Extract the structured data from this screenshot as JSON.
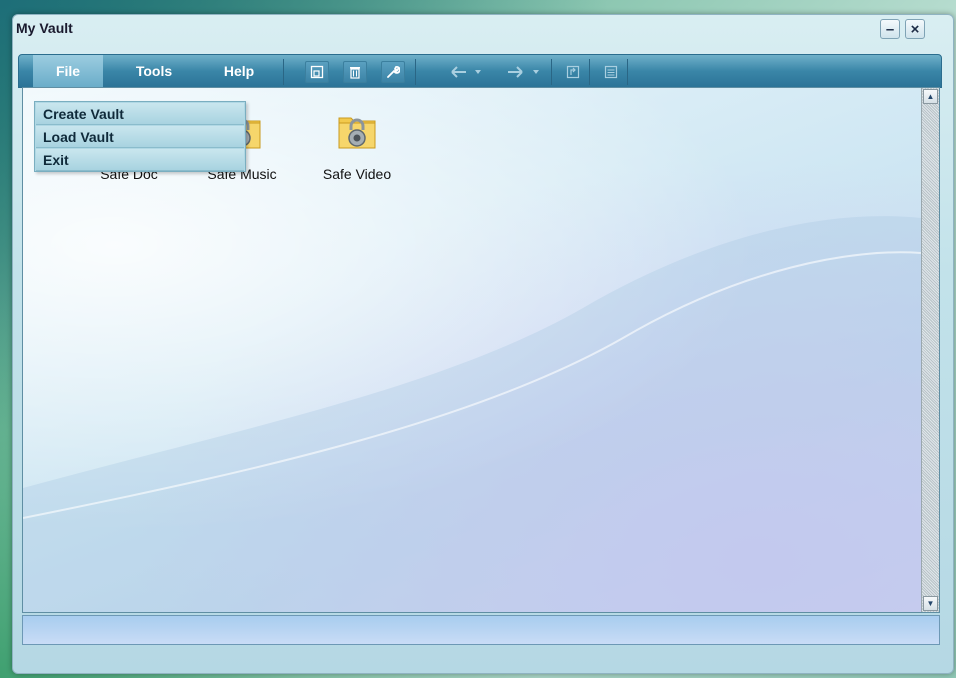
{
  "window": {
    "title": "My Vault"
  },
  "window_controls": {
    "minimize": "–",
    "close": "×"
  },
  "menubar": {
    "items": [
      {
        "label": "File",
        "active": true
      },
      {
        "label": "Tools"
      },
      {
        "label": "Help"
      }
    ]
  },
  "toolbar": {
    "buttons": [
      "new-vault-icon",
      "trash-icon",
      "wrench-icon",
      "back-arrow-icon",
      "back-dropdown-icon",
      "forward-arrow-icon",
      "forward-dropdown-icon",
      "folder-up-icon",
      "view-list-icon"
    ]
  },
  "file_menu": {
    "items": [
      {
        "label": "Create Vault"
      },
      {
        "label": "Load Vault"
      },
      {
        "label": "Exit"
      }
    ]
  },
  "vaults": [
    {
      "label": "Safe Doc"
    },
    {
      "label": "Safe Music"
    },
    {
      "label": "Safe Video"
    }
  ],
  "scrollbar": {
    "up_glyph": "▲",
    "down_glyph": "▼"
  },
  "colors": {
    "menubar": "#3a86a8",
    "folder": "#f2c94c",
    "lock": "#9aa3a8"
  }
}
